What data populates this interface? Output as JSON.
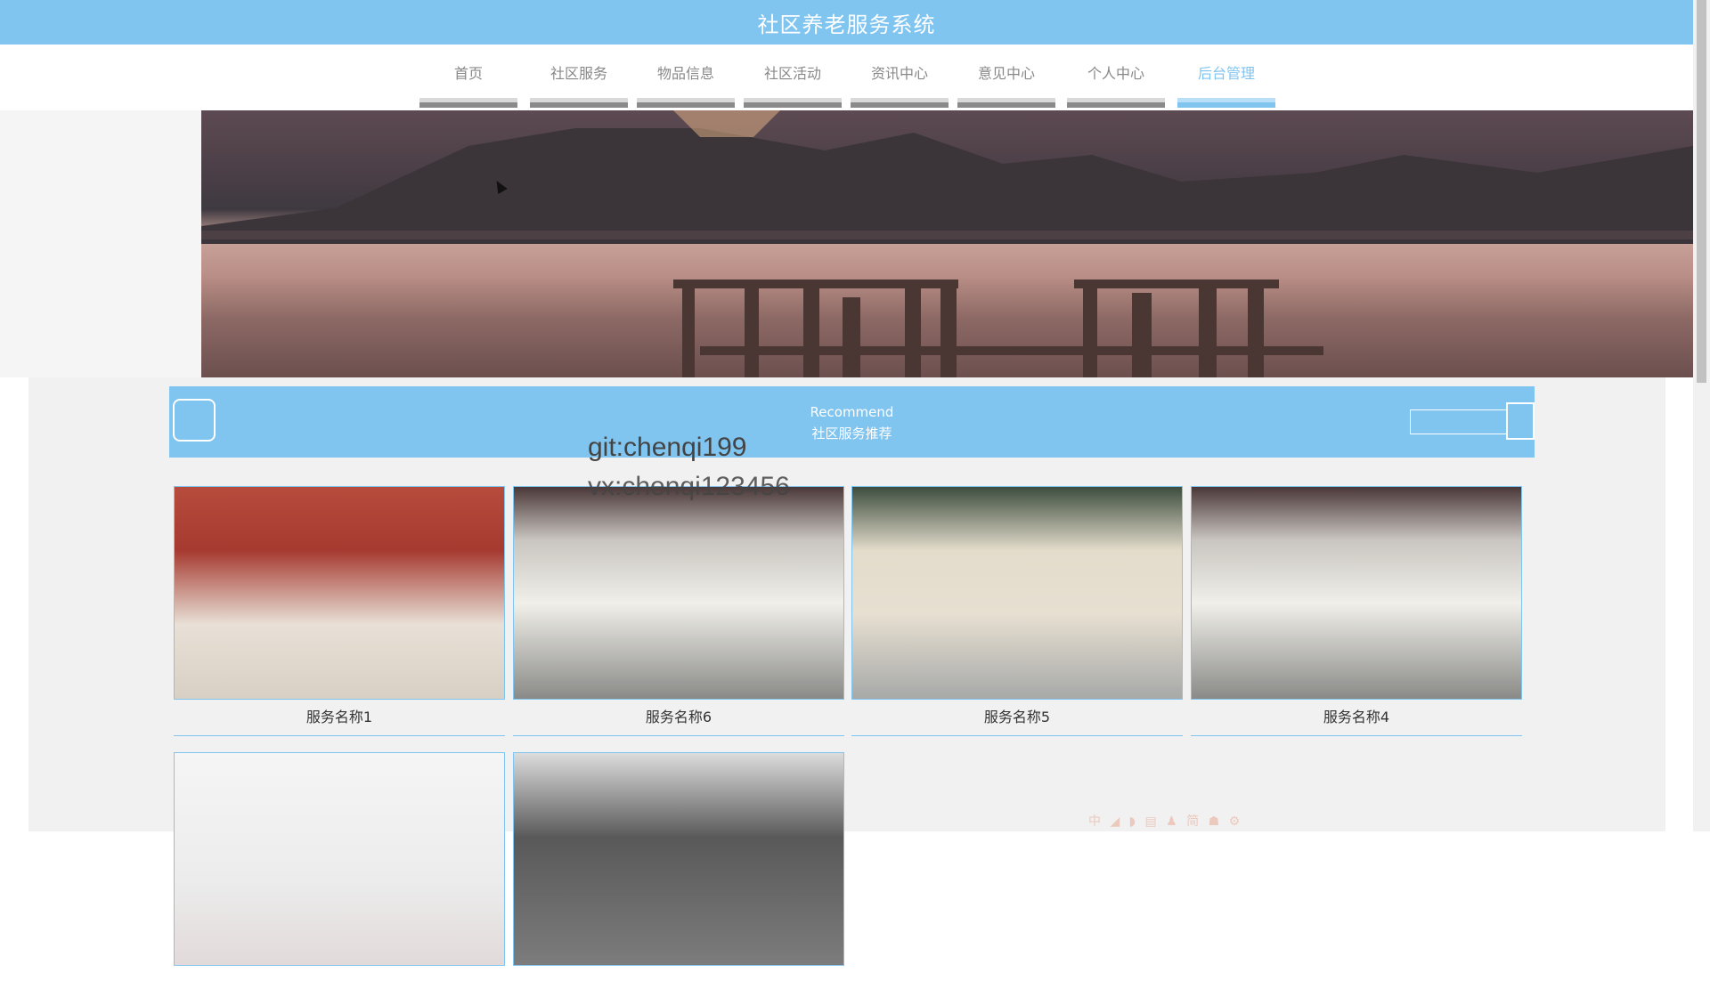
{
  "header": {
    "title": "社区养老服务系统"
  },
  "nav": {
    "items": [
      {
        "label": "首页"
      },
      {
        "label": "社区服务"
      },
      {
        "label": "物品信息"
      },
      {
        "label": "社区活动"
      },
      {
        "label": "资讯中心"
      },
      {
        "label": "意见中心"
      },
      {
        "label": "个人中心"
      },
      {
        "label": "后台管理"
      }
    ],
    "active_index": 7
  },
  "recommend": {
    "title_en": "Recommend",
    "title_cn": "社区服务推荐"
  },
  "watermark": {
    "line1": "git:chenqi199",
    "line2": "vx:chenqi123456"
  },
  "services": [
    {
      "name": "服务名称1"
    },
    {
      "name": "服务名称6"
    },
    {
      "name": "服务名称5"
    },
    {
      "name": "服务名称4"
    },
    {
      "name": ""
    },
    {
      "name": ""
    }
  ],
  "toolbar": {
    "text": "中 ◢ ◗ ▤ ♟ 简 ☗ ⚙"
  },
  "colors": {
    "accent": "#80c4f0",
    "nav_text": "#888888"
  }
}
